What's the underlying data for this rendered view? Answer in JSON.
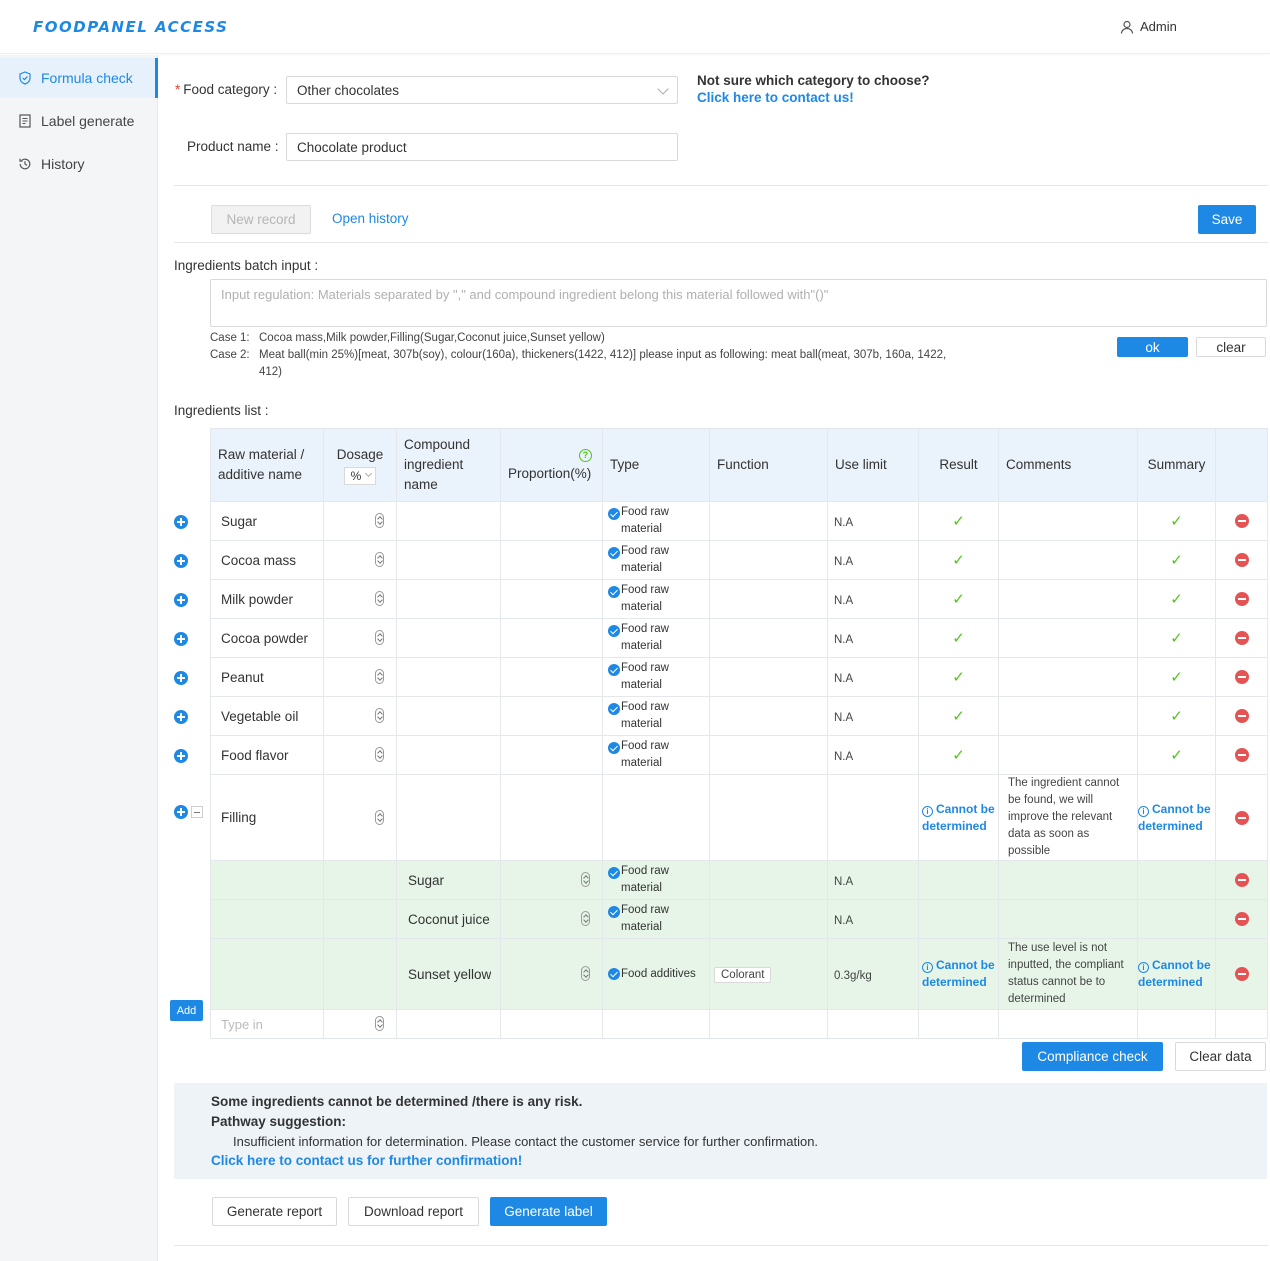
{
  "app": {
    "logo": "FOODPANEL ACCESS",
    "user": "Admin"
  },
  "sidebar": {
    "items": [
      {
        "label": "Formula check",
        "icon": "shield-icon",
        "active": true
      },
      {
        "label": "Label generate",
        "icon": "document-icon",
        "active": false
      },
      {
        "label": "History",
        "icon": "history-icon",
        "active": false
      }
    ]
  },
  "form": {
    "food_category_label": "Food category :",
    "food_category_value": "Other chocolates",
    "product_name_label": "Product name :",
    "product_name_value": "Chocolate product",
    "hint_title": "Not sure which category to choose?",
    "hint_link": "Click here to contact us!"
  },
  "toolbar": {
    "new_record": "New record",
    "open_history": "Open history",
    "save": "Save"
  },
  "batch": {
    "label": "Ingredients batch input :",
    "placeholder": "Input regulation: Materials separated by \",\" and compound ingredient belong this material followed with\"()\"",
    "case1_label": "Case 1:",
    "case1_text": "Cocoa mass,Milk powder,Filling(Sugar,Coconut juice,Sunset yellow)",
    "case2_label": "Case 2:",
    "case2_text": "Meat ball(min 25%)[meat, 307b(soy), colour(160a), thickeners(1422, 412)] please input as following: meat ball(meat, 307b, 160a, 1422,",
    "case2_text_cont": "412)",
    "ok": "ok",
    "clear": "clear"
  },
  "ingredients": {
    "label": "Ingredients list :",
    "headers": {
      "raw": "Raw material / additive name",
      "dosage": "Dosage",
      "dosage_unit": "%",
      "compound": "Compound ingredient name",
      "proportion": "Proportion(%)",
      "type": "Type",
      "function": "Function",
      "use_limit": "Use limit",
      "result": "Result",
      "comments": "Comments",
      "summary": "Summary"
    },
    "rows": [
      {
        "name": "Sugar",
        "type": "Food raw material",
        "use_limit": "N.A",
        "result": "✓",
        "summary": "✓"
      },
      {
        "name": "Cocoa mass",
        "type": "Food raw material",
        "use_limit": "N.A",
        "result": "✓",
        "summary": "✓"
      },
      {
        "name": "Milk powder",
        "type": "Food raw material",
        "use_limit": "N.A",
        "result": "✓",
        "summary": "✓"
      },
      {
        "name": "Cocoa powder",
        "type": "Food raw material",
        "use_limit": "N.A",
        "result": "✓",
        "summary": "✓"
      },
      {
        "name": "Peanut",
        "type": "Food raw material",
        "use_limit": "N.A",
        "result": "✓",
        "summary": "✓"
      },
      {
        "name": "Vegetable oil",
        "type": "Food raw material",
        "use_limit": "N.A",
        "result": "✓",
        "summary": "✓"
      },
      {
        "name": "Food flavor",
        "type": "Food raw material",
        "use_limit": "N.A",
        "result": "✓",
        "summary": "✓"
      }
    ],
    "filling": {
      "name": "Filling",
      "result": "Cannot be determined",
      "comment": "The ingredient cannot be found, we will improve the relevant data as soon as possible",
      "summary": "Cannot be determined"
    },
    "sub_rows": [
      {
        "name": "Sugar",
        "type": "Food raw material",
        "use_limit": "N.A"
      },
      {
        "name": "Coconut juice",
        "type": "Food raw material",
        "use_limit": "N.A"
      },
      {
        "name": "Sunset yellow",
        "type": "Food additives",
        "function": "Colorant",
        "use_limit": "0.3g/kg",
        "result": "Cannot be determined",
        "comment": "The use level is not inputted, the compliant status cannot be to determined",
        "summary": "Cannot be determined"
      }
    ],
    "add_button": "Add",
    "add_placeholder": "Type in"
  },
  "actions": {
    "compliance_check": "Compliance check",
    "clear_data": "Clear data"
  },
  "result": {
    "headline": "Some ingredients cannot be determined /there is any risk.",
    "pathway_label": "Pathway suggestion:",
    "pathway_text": "Insufficient information for determination. Please contact the customer service for further confirmation.",
    "contact_link": "Click here to contact us for further confirmation!"
  },
  "report": {
    "generate_report": "Generate report",
    "download_report": "Download report",
    "generate_label": "Generate label"
  },
  "colors": {
    "primary": "#1e88e5",
    "success": "#52c41a",
    "danger": "#e45454",
    "sub_row_bg": "#e6f5e8",
    "header_bg": "#eaf2fb"
  }
}
